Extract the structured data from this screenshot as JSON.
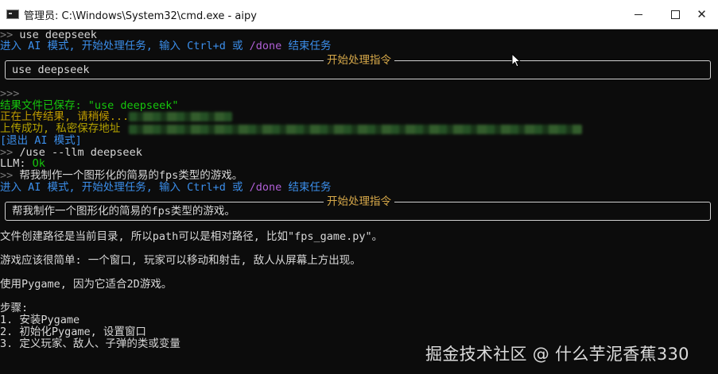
{
  "window": {
    "title": "管理员: C:\\Windows\\System32\\cmd.exe - aipy",
    "minimize": "—",
    "maximize": "☐",
    "close": "✕"
  },
  "console": {
    "l1": {
      "prompt": ">>",
      "cmd": " use deepseek"
    },
    "l2": {
      "a": "进入 AI 模式, 开始处理任务, 输入 Ctrl+d 或 ",
      "b": "/done",
      "c": " 结束任务"
    },
    "box1": {
      "title": "开始处理指令",
      "text": "use deepseek"
    },
    "l3": ">>>",
    "l4": "结果文件已保存: \"use deepseek\"",
    "l5": "正在上传结果, 请稍候...",
    "l6": "上传成功, 私密保存地址",
    "l7": "[退出 AI 模式]",
    "l8": {
      "prompt": ">>",
      "cmd": " /use --llm deepseek"
    },
    "l9": {
      "a": "LLM: ",
      "b": "Ok"
    },
    "l10": {
      "prompt": ">>",
      "cmd": " 帮我制作一个图形化的简易的fps类型的游戏。"
    },
    "l11": {
      "a": "进入 AI 模式, 开始处理任务, 输入 Ctrl+d 或 ",
      "b": "/done",
      "c": " 结束任务"
    },
    "box2": {
      "title": "开始处理指令",
      "text": "帮我制作一个图形化的简易的fps类型的游戏。"
    },
    "p1": "文件创建路径是当前目录, 所以path可以是相对路径, 比如\"fps_game.py\"。",
    "p2": "游戏应该很简单: 一个窗口, 玩家可以移动和射击, 敌人从屏幕上方出现。",
    "p3": "使用Pygame, 因为它适合2D游戏。",
    "p4": "步骤:",
    "s1": "1. 安装Pygame",
    "s2": "2. 初始化Pygame, 设置窗口",
    "s3": "3. 定义玩家、敌人、子弹的类或变量"
  },
  "watermark": "掘金技术社区 @ 什么芋泥香蕉330"
}
